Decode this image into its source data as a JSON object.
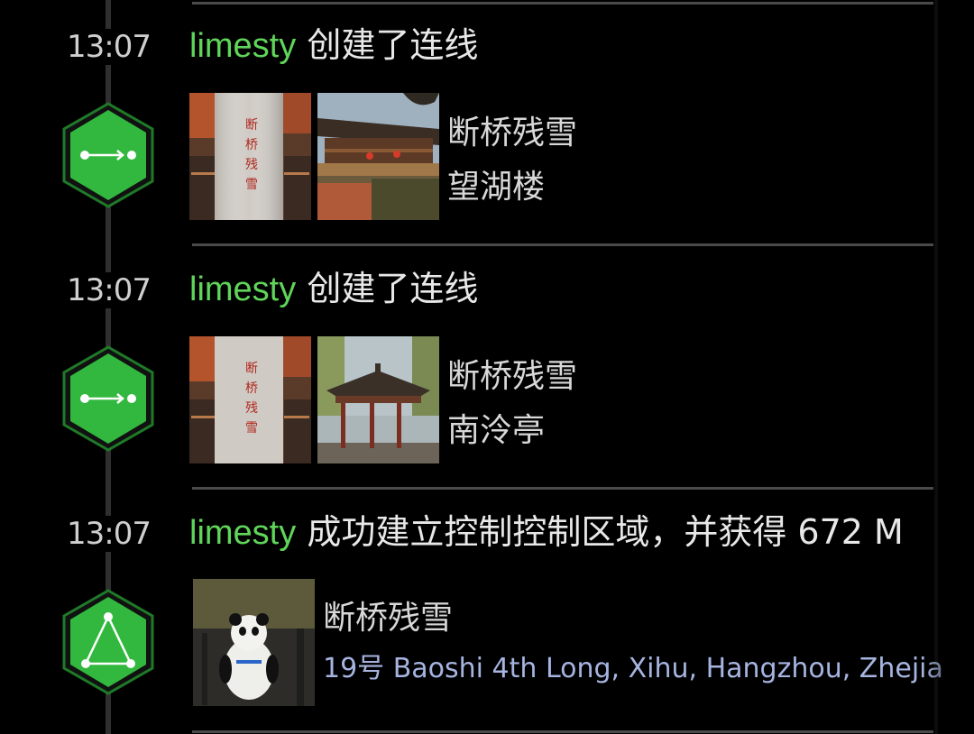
{
  "colors": {
    "background": "#000000",
    "username": "#5fd55a",
    "hex_fill": "#32b83e",
    "hex_border": "#1f7a28",
    "address": "#a6b4e0",
    "divider": "#4a4a4a"
  },
  "entries": [
    {
      "time": "13:07",
      "user": "limesty",
      "action": "创建了连线",
      "icon": "link-arrow-icon",
      "portals": [
        "断桥残雪",
        "望湖楼"
      ]
    },
    {
      "time": "13:07",
      "user": "limesty",
      "action": "创建了连线",
      "icon": "link-arrow-icon",
      "portals": [
        "断桥残雪",
        "南泠亭"
      ]
    },
    {
      "time": "13:07",
      "user": "limesty",
      "action": "成功建立控制控制区域，并获得 672 M",
      "icon": "control-field-triangle-icon",
      "portal": "断桥残雪",
      "address": "19号 Baoshi 4th Long, Xihu, Hangzhou, Zhejia"
    }
  ]
}
